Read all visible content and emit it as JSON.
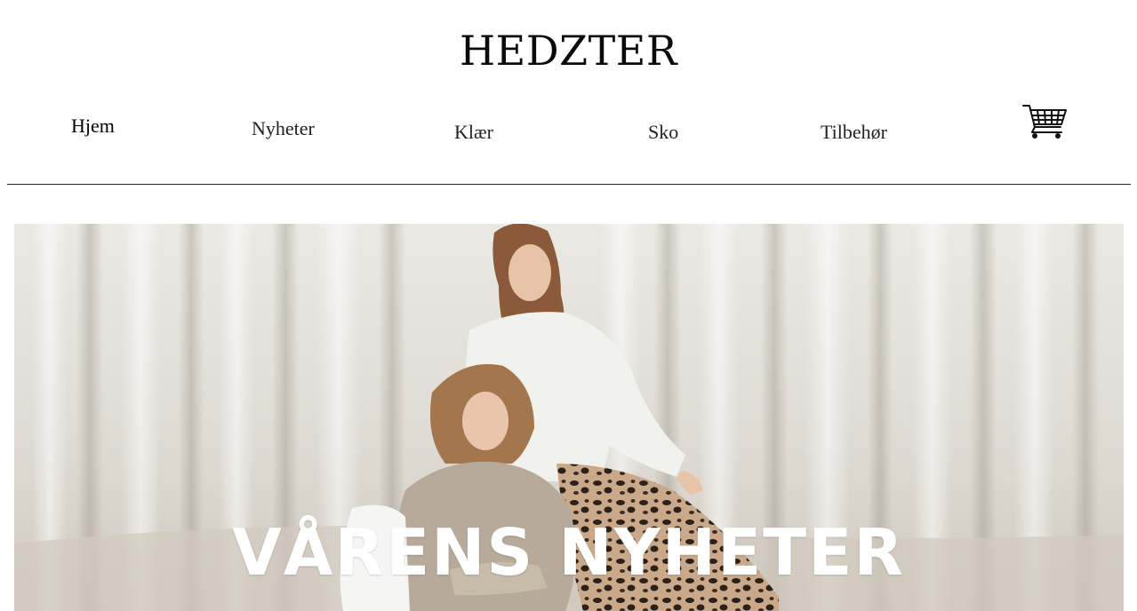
{
  "brand": {
    "logo_text": "HEDZTER"
  },
  "nav": {
    "items": [
      {
        "label": "Hjem",
        "active": true
      },
      {
        "label": "Nyheter",
        "active": false
      },
      {
        "label": "Klær",
        "active": false
      },
      {
        "label": "Sko",
        "active": false
      },
      {
        "label": "Tilbehør",
        "active": false
      }
    ],
    "cart_icon": "shopping-cart-icon"
  },
  "hero": {
    "title": "VÅRENS NYHETER",
    "colors": {
      "backdrop": "#e6e3dd",
      "sweater_light": "#f1f1ee",
      "sweater_beige": "#b8aa9a",
      "title": "#ffffff"
    }
  }
}
